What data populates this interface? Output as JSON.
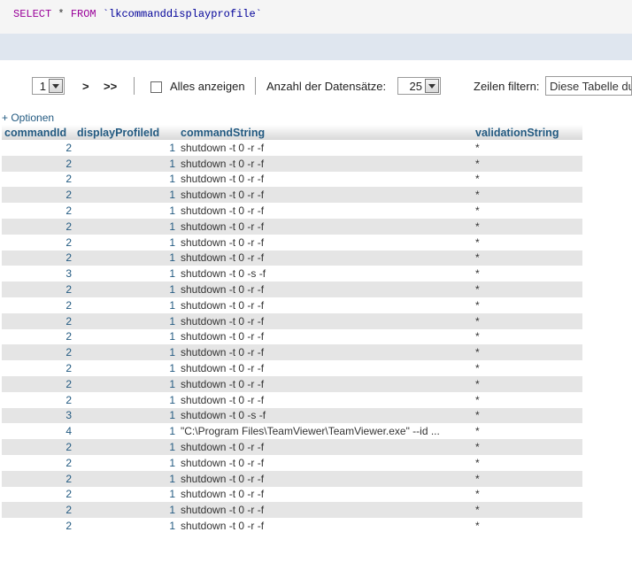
{
  "query": {
    "kw_select": "SELECT",
    "star": " * ",
    "kw_from": "FROM",
    "table": " `lkcommanddisplayprofile`"
  },
  "navigation": {
    "page_select_value": "1",
    "next_label": ">",
    "last_label": ">>",
    "show_all_label": "Alles anzeigen",
    "rowcount_label": "Anzahl der Datensätze:",
    "rowcount_value": "25",
    "filter_label": "Zeilen filtern:",
    "filter_placeholder": "Diese Tabelle du"
  },
  "options_label": "+ Optionen",
  "table": {
    "columns": [
      "commandId",
      "displayProfileId",
      "commandString",
      "validationString"
    ],
    "rows": [
      [
        "2",
        "1",
        "shutdown -t 0 -r -f",
        "*"
      ],
      [
        "2",
        "1",
        "shutdown -t 0 -r -f",
        "*"
      ],
      [
        "2",
        "1",
        "shutdown -t 0 -r -f",
        "*"
      ],
      [
        "2",
        "1",
        "shutdown -t 0 -r -f",
        "*"
      ],
      [
        "2",
        "1",
        "shutdown -t 0 -r -f",
        "*"
      ],
      [
        "2",
        "1",
        "shutdown -t 0 -r -f",
        "*"
      ],
      [
        "2",
        "1",
        "shutdown -t 0 -r -f",
        "*"
      ],
      [
        "2",
        "1",
        "shutdown -t 0 -r -f",
        "*"
      ],
      [
        "3",
        "1",
        "shutdown -t 0 -s -f",
        "*"
      ],
      [
        "2",
        "1",
        "shutdown -t 0 -r -f",
        "*"
      ],
      [
        "2",
        "1",
        "shutdown -t 0 -r -f",
        "*"
      ],
      [
        "2",
        "1",
        "shutdown -t 0 -r -f",
        "*"
      ],
      [
        "2",
        "1",
        "shutdown -t 0 -r -f",
        "*"
      ],
      [
        "2",
        "1",
        "shutdown -t 0 -r -f",
        "*"
      ],
      [
        "2",
        "1",
        "shutdown -t 0 -r -f",
        "*"
      ],
      [
        "2",
        "1",
        "shutdown -t 0 -r -f",
        "*"
      ],
      [
        "2",
        "1",
        "shutdown -t 0 -r -f",
        "*"
      ],
      [
        "3",
        "1",
        "shutdown -t 0 -s -f",
        "*"
      ],
      [
        "4",
        "1",
        "\"C:\\Program Files\\TeamViewer\\TeamViewer.exe\" --id ...",
        "*"
      ],
      [
        "2",
        "1",
        "shutdown -t 0 -r -f",
        "*"
      ],
      [
        "2",
        "1",
        "shutdown -t 0 -r -f",
        "*"
      ],
      [
        "2",
        "1",
        "shutdown -t 0 -r -f",
        "*"
      ],
      [
        "2",
        "1",
        "shutdown -t 0 -r -f",
        "*"
      ],
      [
        "2",
        "1",
        "shutdown -t 0 -r -f",
        "*"
      ],
      [
        "2",
        "1",
        "shutdown -t 0 -r -f",
        "*"
      ]
    ]
  }
}
